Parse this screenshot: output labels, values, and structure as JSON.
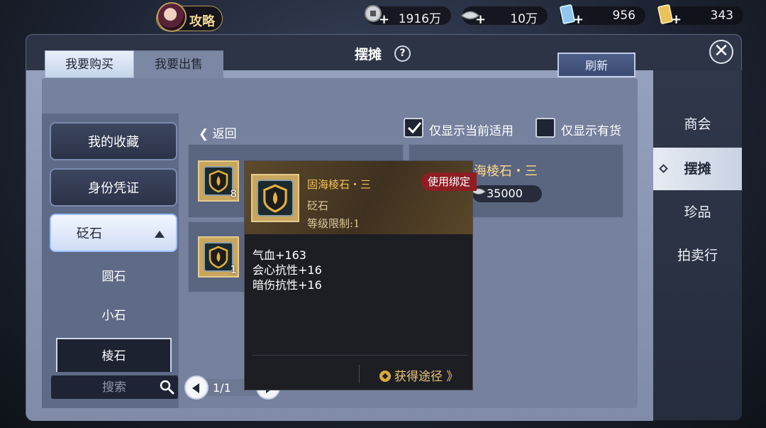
{
  "topbar": {
    "guide_label": "攻略",
    "currencies": [
      {
        "icon": "silver-coin-icon",
        "value": "1916万"
      },
      {
        "icon": "silver-ingot-icon",
        "value": "10万"
      },
      {
        "icon": "blue-ticket-icon",
        "value": "956"
      },
      {
        "icon": "gold-ticket-icon",
        "value": "343"
      }
    ]
  },
  "panel": {
    "title": "摆摊",
    "help": "?"
  },
  "tabs": {
    "buy": "我要购买",
    "sell": "我要出售"
  },
  "refresh_label": "刷新",
  "right_nav": [
    "商会",
    "摆摊",
    "珍品",
    "拍卖行"
  ],
  "categories": [
    "我的收藏",
    "身份凭证",
    "砭石"
  ],
  "subcategories": [
    "圆石",
    "小石",
    "棱石"
  ],
  "filters": {
    "back": "返回",
    "current_applicable": "仅显示当前适用",
    "in_stock": "仅显示有货"
  },
  "search": {
    "placeholder": "搜索"
  },
  "pager": {
    "text": "1/1"
  },
  "items": [
    {
      "qty": "8",
      "name": "",
      "price": ""
    },
    {
      "qty": "",
      "name": "固海棱石・三",
      "price": "35000"
    },
    {
      "qty": "1",
      "name": "",
      "price": ""
    }
  ],
  "tooltip": {
    "name": "固海棱石・三",
    "badge": "使用绑定",
    "type": "砭石",
    "level": "等级限制:1",
    "attrs": [
      "气血+163",
      "会心抗性+16",
      "暗伤抗性+16"
    ],
    "source": "获得途径 》"
  },
  "colors": {
    "accent_gold": "#f2c25a",
    "badge_red": "#8e1d24",
    "active_tab": "#e8f0fb"
  }
}
